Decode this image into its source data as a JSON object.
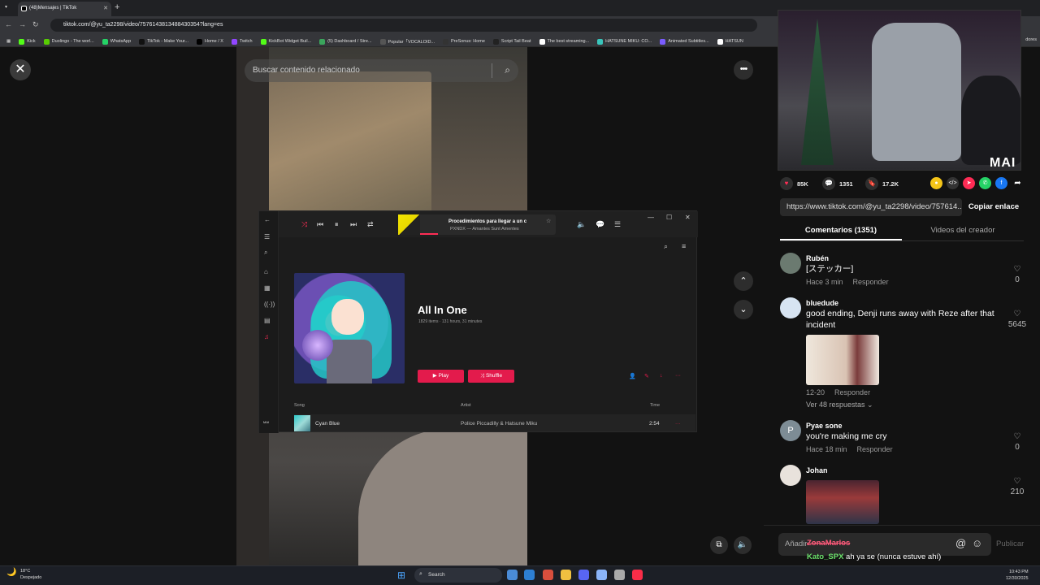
{
  "browser": {
    "tab_title": "(48)Mensajes | TikTok",
    "url": "tiktok.com/@yu_ta2298/video/7576143813488430354?lang=es",
    "bookmarks": [
      {
        "label": "Kick",
        "color": "#53fc18"
      },
      {
        "label": "Duolingo - The worl...",
        "color": "#58cc02"
      },
      {
        "label": "WhatsApp",
        "color": "#25d366"
      },
      {
        "label": "TikTok - Make Your...",
        "color": "#111111"
      },
      {
        "label": "Home / X",
        "color": "#000000"
      },
      {
        "label": "Twitch",
        "color": "#9146ff"
      },
      {
        "label": "KickBot Widget Buil...",
        "color": "#53fc18"
      },
      {
        "label": "(5) Dashboard / Stre...",
        "color": "#3ba55c"
      },
      {
        "label": "Popular「VOCALOID...",
        "color": "#555555"
      },
      {
        "label": "PreSonus: Home",
        "color": "#333333"
      },
      {
        "label": "Script Tail Beat",
        "color": "#222222"
      },
      {
        "label": "The best streaming...",
        "color": "#ffffff"
      },
      {
        "label": "HATSUNE MIKU: CO...",
        "color": "#39c5bb"
      },
      {
        "label": "Animated Subtitles...",
        "color": "#7a5cff"
      },
      {
        "label": "HATSUN",
        "color": "#ffffff"
      }
    ],
    "bookmarks_more": "dores"
  },
  "video": {
    "search_placeholder": "Buscar contenido relacionado"
  },
  "player": {
    "now_playing_title": "Procedimientos para llegar a un c",
    "now_playing_artist": "PXNDX — Amantes Sunt Amentes",
    "album_title": "All In One",
    "album_meta": "1829 items · 131 hours, 31 minutes",
    "play_label": "▶ Play",
    "shuffle_label": "⤨ Shuffle",
    "col_song": "Song",
    "col_artist": "Artist",
    "col_time": "Time",
    "track": {
      "song": "Cyan Blue",
      "artist": "Police Piccadilly & Hatsune Miku",
      "time": "2:54"
    },
    "avatar_text": "MAI"
  },
  "panel": {
    "cam_label": "MAI",
    "likes": "85K",
    "comments_count": "1351",
    "saves": "17.2K",
    "link": "https://www.tiktok.com/@yu_ta2298/video/757614...",
    "copy_label": "Copiar enlace",
    "tab_comments": "Comentarios (1351)",
    "tab_videos": "Videos del creador",
    "comments": [
      {
        "user": "Rubén",
        "text": "[ステッカー]",
        "time": "Hace 3 min",
        "reply": "Responder",
        "likes": "0"
      },
      {
        "user": "bluedude",
        "text": "good ending, Denji runs away with Reze after that incident",
        "time": "12-20",
        "reply": "Responder",
        "likes": "5645"
      },
      {
        "user": "Pyae sone",
        "text": "you're making me cry",
        "time": "Hace 18 min",
        "reply": "Responder",
        "likes": "0",
        "avatar_letter": "P"
      },
      {
        "user": "Johan",
        "text": "",
        "time": "",
        "reply": "",
        "likes": "210"
      }
    ],
    "more_replies": "Ver 48 respuestas ⌄",
    "input_placeholder": "Añadir",
    "publish_label": "Publicar",
    "chat_line1": "ZonaMarlos",
    "chat_line2_user": "Kato_SPX",
    "chat_line2_text": "ah ya se (nunca estuve ahí)"
  },
  "taskbar": {
    "temp": "18°C",
    "weather": "Despejado",
    "search_label": "Search",
    "time": "10:43 PM",
    "date": "12/30/2025"
  }
}
